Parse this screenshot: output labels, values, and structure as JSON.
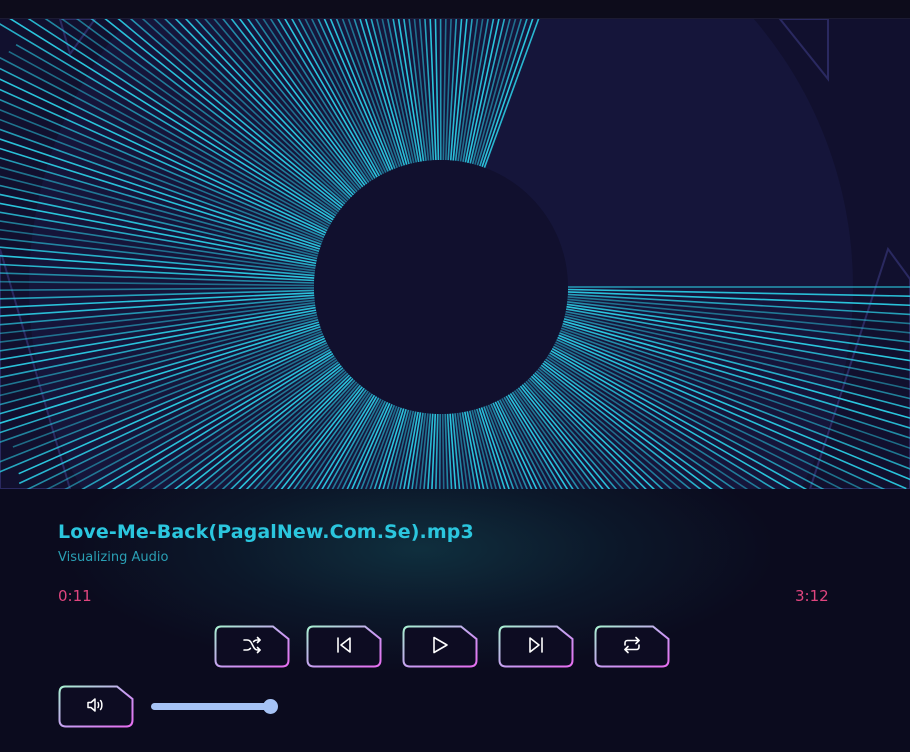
{
  "track": {
    "title": "Love-Me-Back(PagalNew.Com.Se).mp3",
    "status": "Visualizing Audio"
  },
  "time": {
    "current": "0:11",
    "duration": "3:12"
  },
  "controls": [
    {
      "name": "shuffle-button",
      "icon": "shuffle-icon"
    },
    {
      "name": "previous-button",
      "icon": "skip-back-icon"
    },
    {
      "name": "play-button",
      "icon": "play-icon"
    },
    {
      "name": "next-button",
      "icon": "skip-forward-icon"
    },
    {
      "name": "repeat-button",
      "icon": "repeat-icon"
    }
  ],
  "volume": {
    "icon": "volume-icon",
    "level": 1.0
  },
  "colors": {
    "accent": "#2bc6de",
    "time": "#e0457f",
    "background": "#0b0b1e",
    "visualizer_bg": "#11102e",
    "slider": "#a6c3f5",
    "button_gradient": [
      "#a8f0d0",
      "#c89cf2",
      "#e76df0"
    ]
  }
}
